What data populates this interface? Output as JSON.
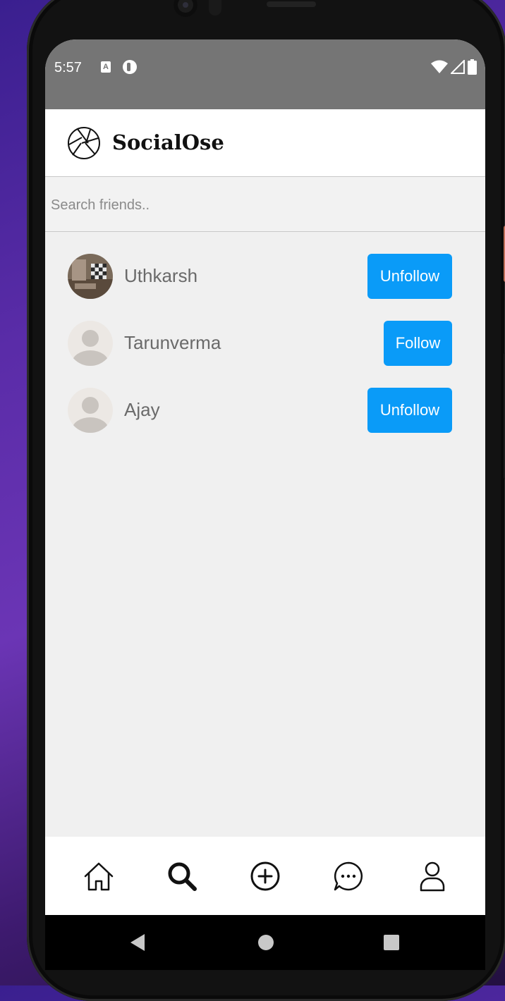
{
  "status_bar": {
    "time": "5:57",
    "notification_icons": [
      "accessibility-a-icon",
      "pause-circle-icon"
    ],
    "right_icons": [
      "wifi-icon",
      "signal-icon",
      "battery-icon"
    ]
  },
  "app_bar": {
    "title": "SocialOse",
    "logo_icon": "aperture-icon"
  },
  "search": {
    "placeholder": "Search friends..",
    "value": ""
  },
  "users": [
    {
      "name": "Uthkarsh",
      "action": "Unfollow",
      "avatar": "photo"
    },
    {
      "name": "Tarunverma",
      "action": "Follow",
      "avatar": "default"
    },
    {
      "name": "Ajay",
      "action": "Unfollow",
      "avatar": "default"
    }
  ],
  "bottom_tabs": [
    {
      "name": "home",
      "icon": "home-icon",
      "active": false
    },
    {
      "name": "search",
      "icon": "search-icon",
      "active": true
    },
    {
      "name": "create",
      "icon": "plus-circle-icon",
      "active": false
    },
    {
      "name": "messages",
      "icon": "chat-bubble-icon",
      "active": false
    },
    {
      "name": "profile",
      "icon": "user-icon",
      "active": false
    }
  ],
  "colors": {
    "accent": "#0a9bf8",
    "status_bar": "#757575",
    "background": "#f0f0f0"
  }
}
